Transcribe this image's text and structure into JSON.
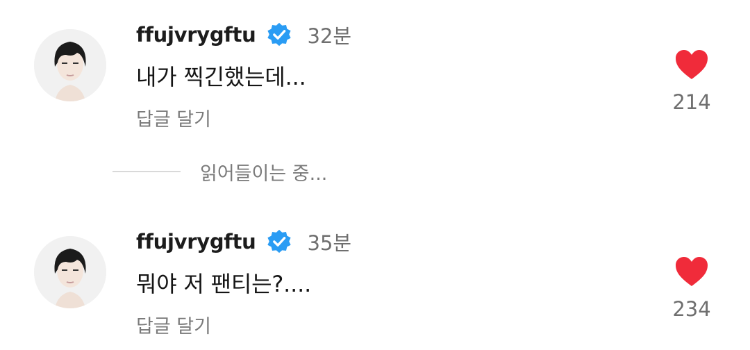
{
  "comments": [
    {
      "username": "ffujvrygftu",
      "time": "32분",
      "text": "내가 찍긴했는데...",
      "reply_label": "답글 달기",
      "likes": "214"
    },
    {
      "username": "ffujvrygftu",
      "time": "35분",
      "text": "뭐야 저 팬티는?....",
      "reply_label": "답글 달기",
      "likes": "234"
    }
  ],
  "loading": {
    "label": "읽어들이는 중..."
  },
  "colors": {
    "verified": "#2a9cf4",
    "heart": "#f02b3a",
    "muted": "#6f6f6f"
  },
  "icons": {
    "verified": "verified-badge-icon",
    "like": "heart-icon"
  }
}
